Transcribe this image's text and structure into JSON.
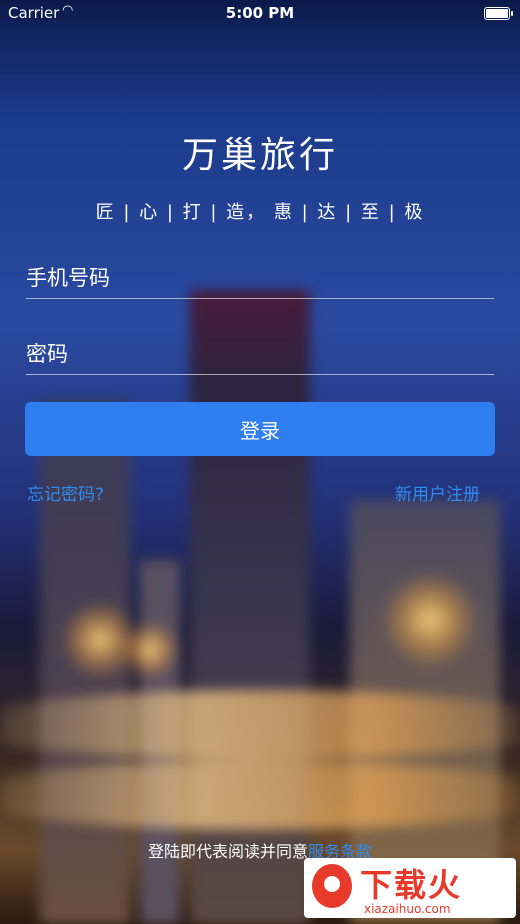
{
  "status": {
    "carrier": "Carrier",
    "time": "5:00 PM"
  },
  "app": {
    "title": "万巢旅行",
    "slogan": "匠 | 心 | 打 | 造， 惠 | 达 | 至 | 极"
  },
  "form": {
    "phone_placeholder": "手机号码",
    "password_placeholder": "密码",
    "login_label": "登录"
  },
  "links": {
    "forgot": "忘记密码?",
    "register": "新用户注册"
  },
  "terms": {
    "text": "登陆即代表阅读并同意",
    "link": "服务条款"
  },
  "watermark": {
    "name": "下载火",
    "url": "xiazaihuo.com"
  },
  "colors": {
    "accent": "#2f7ef0",
    "link": "#2f8cf0",
    "watermark": "#e83a2a"
  }
}
